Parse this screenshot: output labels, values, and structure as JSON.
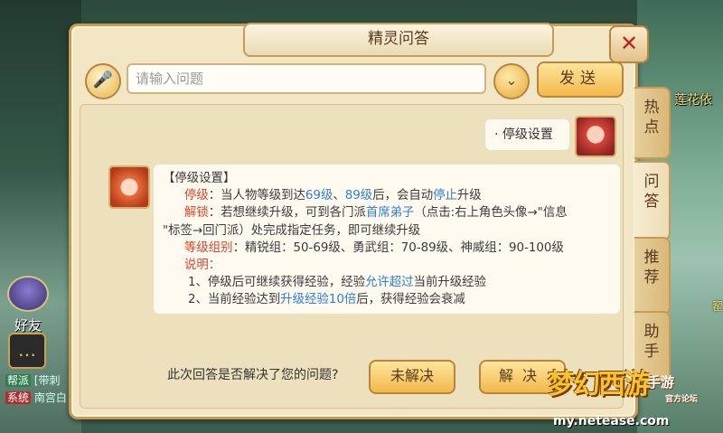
{
  "background": {
    "npc_name": "莲花依",
    "npc_name2": "翟",
    "friends_label": "好友",
    "chat_lines": [
      {
        "tag": "帮派",
        "text": "[带刺"
      },
      {
        "tag": "系统",
        "text": "南宫白"
      }
    ]
  },
  "dialog": {
    "title": "精灵问答",
    "close_glyph": "✕",
    "input": {
      "placeholder": "请输入问题",
      "value": ""
    },
    "send_label": "发送",
    "tabs": [
      "热点",
      "问答",
      "推荐",
      "助手"
    ],
    "user_question": "· 停级设置",
    "answer": {
      "heading": "【停级设置】",
      "l1_label": "停级",
      "l1_a": "：当人物等级到达",
      "l1_b": "69级",
      "l1_c": "、",
      "l1_d": "89级",
      "l1_e": "后，会自动",
      "l1_f": "停止",
      "l1_g": "升级",
      "l2_label": "解锁",
      "l2_a": "：若想继续升级，可到各门派",
      "l2_b": "首席弟子",
      "l2_c": "（点击:右上角色头像→\"信息",
      "l3": "\"标签→回门派）处完成指定任务，即可继续升级",
      "l4_label": "等级组别",
      "l4_a": "：精锐组：50-69级、勇武组：70-89级、神威组：90-100级",
      "l5_label": "说明：",
      "l6_a": "1、停级后可继续获得经验，经验",
      "l6_b": "允许超过",
      "l6_c": "当前升级经验",
      "l7_a": "2、当前经验达到",
      "l7_b": "升级经验10倍",
      "l7_c": "后，获得经验会衰减"
    },
    "feedback_question": "此次回答是否解决了您的问题?",
    "unsolved_label": "未解决",
    "solved_label": "解决"
  },
  "logo": {
    "name": "梦幻西游",
    "sub": "手游",
    "sub2": "官方论坛",
    "url": "my.netease.com"
  }
}
